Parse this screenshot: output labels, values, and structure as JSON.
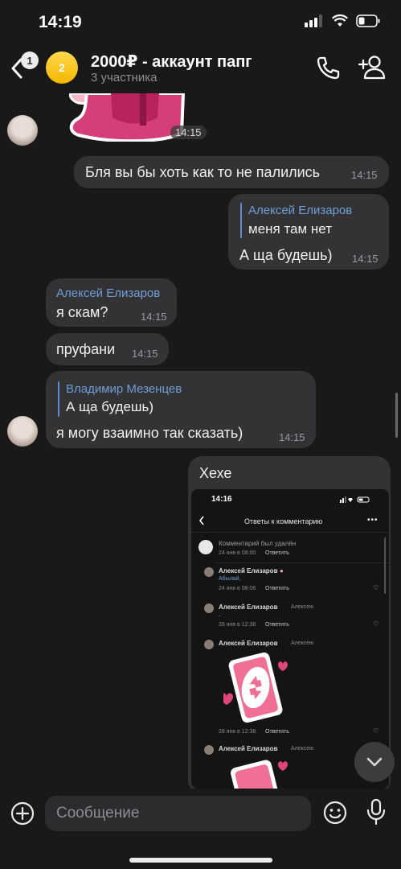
{
  "status_bar": {
    "time": "14:19"
  },
  "header": {
    "back_badge": "1",
    "avatar_text": "2",
    "title": "2000₽ - аккаунт папг",
    "subtitle": "3 участника"
  },
  "messages": {
    "sticker_time": "14:15",
    "m1": {
      "text": "Бля вы бы хоть как то не палились",
      "time": "14:15"
    },
    "m2": {
      "quote_author": "Алексей Елизаров",
      "quote_text": "меня там нет",
      "text": "А ща будешь)",
      "time": "14:15"
    },
    "m3": {
      "author": "Алексей Елизаров",
      "text": "я скам?",
      "time": "14:15"
    },
    "m4": {
      "text": "пруфани",
      "time": "14:15"
    },
    "m5": {
      "quote_author": "Владимир Мезенцев",
      "quote_text": "А ща будешь)",
      "text": "я могу взаимно так сказать)",
      "time": "14:15"
    },
    "m6": {
      "text": "Хехе"
    }
  },
  "screenshot": {
    "time": "14:16",
    "title": "Ответы к комментарию",
    "items": [
      {
        "name": "Комментарий был удалён",
        "meta": "24 янв в 08:00",
        "reply": "Ответить"
      },
      {
        "name": "Алексей Елизаров",
        "body": "Абылай, ",
        "meta": "24 янв в 08:06",
        "reply": "Ответить"
      },
      {
        "name": "Алексей Елизаров",
        "to": "Алексею",
        "body": ".",
        "meta": "28 янв в 12:38",
        "reply": "Ответить"
      },
      {
        "name": "Алексей Елизаров",
        "to": "Алексею",
        "meta": "28 янв в 12:38",
        "reply": "Ответить"
      },
      {
        "name": "Алексей Елизаров",
        "to": "Алексею"
      }
    ]
  },
  "composer": {
    "placeholder": "Сообщение"
  },
  "colors": {
    "background": "#19191a",
    "bubble": "#333335",
    "accent": "#6f9ed6"
  }
}
